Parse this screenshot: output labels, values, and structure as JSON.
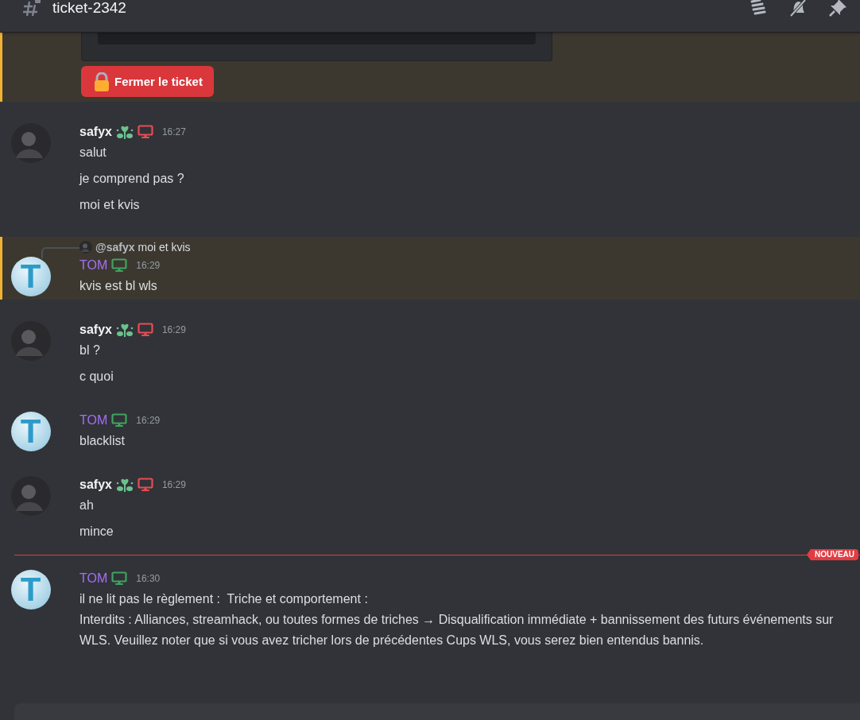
{
  "channel": {
    "name": "ticket-2342"
  },
  "top_embed": {
    "highlighted": true,
    "button": "Fermer le ticket"
  },
  "new_divider_label": "NOUVEAU",
  "messages": [
    {
      "author": "safyx",
      "kind": "member",
      "color": "#e74d52",
      "badge": true,
      "highlighted": false,
      "new_divider": false,
      "time": "16:27",
      "lines": [
        "salut",
        "je comprend pas ?",
        "moi et kvis"
      ]
    },
    {
      "author": "TOM",
      "kind": "staff",
      "avatar_text": "T",
      "color": "#3fa45f",
      "badge": false,
      "highlighted": true,
      "new_divider": false,
      "reply": {
        "mention": "@safyx",
        "text": "moi et kvis"
      },
      "time": "16:29",
      "lines": [
        "kvis est bl wls"
      ]
    },
    {
      "author": "safyx",
      "kind": "member",
      "color": "#e74d52",
      "badge": true,
      "highlighted": false,
      "new_divider": false,
      "time": "16:29",
      "lines": [
        "bl ?",
        "c quoi"
      ]
    },
    {
      "author": "TOM",
      "kind": "staff",
      "avatar_text": "T",
      "color": "#3fa45f",
      "badge": false,
      "highlighted": false,
      "new_divider": false,
      "time": "16:29",
      "lines": [
        "blacklist"
      ]
    },
    {
      "author": "safyx",
      "kind": "member",
      "color": "#e74d52",
      "badge": true,
      "highlighted": false,
      "new_divider": false,
      "time": "16:29",
      "lines": [
        "ah",
        "mince"
      ]
    },
    {
      "author": "TOM",
      "kind": "staff",
      "avatar_text": "T",
      "color": "#3fa45f",
      "badge": false,
      "highlighted": false,
      "new_divider": true,
      "time": "16:30",
      "lines": [
        "il ne lit pas le règlement :  Triche et comportement :\nInterdits : Alliances, streamhack, ou toutes formes de triches → Disqualification immédiate + bannissement des futurs événements sur WLS. Veuillez noter que si vous avez tricher lors de précédentes Cups WLS, vous serez bien entendus bannis."
      ]
    }
  ]
}
